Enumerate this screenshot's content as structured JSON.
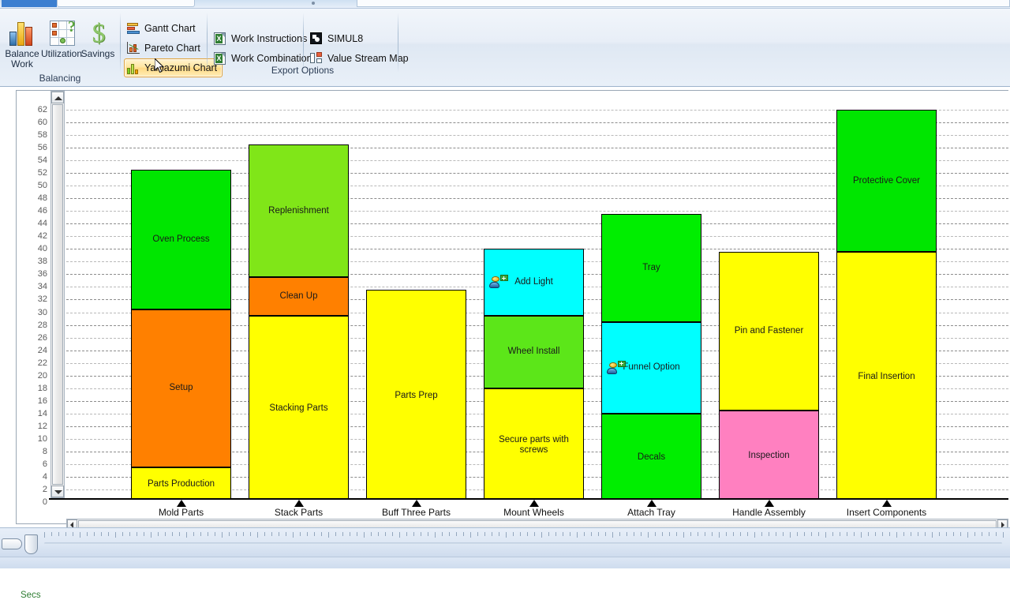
{
  "ribbon": {
    "groups": [
      {
        "name": "Balancing",
        "title": "Balancing"
      },
      {
        "name": "Export Options",
        "title": "Export Options"
      }
    ],
    "balancing": {
      "title": "Balancing",
      "buttons": [
        {
          "label_line1": "Balance",
          "label_line2": "Work",
          "icon": "bar-chart-icon"
        },
        {
          "label_line1": "Utilization",
          "label_line2": "",
          "icon": "grid-question-icon"
        },
        {
          "label_line1": "Savings",
          "label_line2": "",
          "icon": "dollar-icon"
        }
      ]
    },
    "chart_commands": [
      {
        "label": "Gantt Chart",
        "icon": "gantt-icon",
        "selected": false
      },
      {
        "label": "Pareto Chart",
        "icon": "pareto-icon",
        "selected": false
      },
      {
        "label": "Yamazumi Chart",
        "icon": "yamazumi-icon",
        "selected": true
      }
    ],
    "export": {
      "title": "Export Options",
      "commands": [
        {
          "label": "Work Instructions",
          "icon": "excel-icon"
        },
        {
          "label": "Work Combination",
          "icon": "excel-icon"
        },
        {
          "label": "SIMUL8",
          "icon": "simul8-icon"
        },
        {
          "label": "Value Stream Map",
          "icon": "value-stream-map-icon"
        }
      ]
    }
  },
  "chart_axis": {
    "y_unit_label": "Secs",
    "y_ticks": [
      62,
      60,
      58,
      56,
      54,
      52,
      50,
      48,
      46,
      44,
      42,
      40,
      38,
      36,
      34,
      32,
      30,
      28,
      26,
      24,
      22,
      20,
      18,
      16,
      14,
      12,
      10,
      8,
      6,
      4,
      2,
      0
    ]
  },
  "chart_data": {
    "type": "bar",
    "subtype": "stacked-yamazumi",
    "title": "Yamazumi Chart",
    "xlabel": "",
    "ylabel": "Secs",
    "ylim": [
      0,
      62
    ],
    "ytick_step": 2,
    "grid": true,
    "legend": "none",
    "categories": [
      "Mold Parts",
      "Stack Parts",
      "Buff Three Parts",
      "Mount Wheels",
      "Attach Tray",
      "Handle Assembly",
      "Insert Components"
    ],
    "totals": [
      52.5,
      56.5,
      33.5,
      40.0,
      45.5,
      39.5,
      62.0
    ],
    "series": [
      {
        "category": "Mold Parts",
        "total": 52.5,
        "segments": [
          {
            "label": "Parts Production",
            "value": 5.5,
            "color": "#ffff00",
            "resource_icon": false
          },
          {
            "label": "Setup",
            "value": 25.0,
            "color": "#ff8000",
            "resource_icon": false
          },
          {
            "label": "Oven Process",
            "value": 22.0,
            "color": "#00e600",
            "resource_icon": false
          }
        ]
      },
      {
        "category": "Stack Parts",
        "total": 56.5,
        "segments": [
          {
            "label": "Stacking Parts",
            "value": 29.5,
            "color": "#ffff00",
            "resource_icon": false
          },
          {
            "label": "Clean Up",
            "value": 6.0,
            "color": "#ff8000",
            "resource_icon": false
          },
          {
            "label": "Replenishment",
            "value": 21.0,
            "color": "#80e618",
            "resource_icon": false
          }
        ]
      },
      {
        "category": "Buff Three Parts",
        "total": 33.5,
        "segments": [
          {
            "label": "Parts Prep",
            "value": 33.5,
            "color": "#ffff00",
            "resource_icon": false
          }
        ]
      },
      {
        "category": "Mount Wheels",
        "total": 40.0,
        "segments": [
          {
            "label": "Secure parts with screws",
            "value": 18.0,
            "color": "#ffff00",
            "resource_icon": false
          },
          {
            "label": "Wheel Install",
            "value": 11.5,
            "color": "#5ce619",
            "resource_icon": false
          },
          {
            "label": "Add Light",
            "value": 10.5,
            "color": "#00ffff",
            "resource_icon": true
          }
        ]
      },
      {
        "category": "Attach Tray",
        "total": 45.5,
        "segments": [
          {
            "label": "Decals",
            "value": 14.0,
            "color": "#00ee00",
            "resource_icon": false
          },
          {
            "label": "Funnel Option",
            "value": 14.5,
            "color": "#00ffff",
            "resource_icon": true
          },
          {
            "label": "Tray",
            "value": 17.0,
            "color": "#00ee00",
            "resource_icon": false
          }
        ]
      },
      {
        "category": "Handle Assembly",
        "total": 39.5,
        "segments": [
          {
            "label": "Inspection",
            "value": 14.5,
            "color": "#ff80c0",
            "resource_icon": false
          },
          {
            "label": "Pin and Fastener",
            "value": 25.0,
            "color": "#ffff00",
            "resource_icon": false
          }
        ]
      },
      {
        "category": "Insert Components",
        "total": 62.0,
        "segments": [
          {
            "label": "Final Insertion",
            "value": 39.5,
            "color": "#ffff00",
            "resource_icon": false
          },
          {
            "label": "Protective Cover",
            "value": 22.5,
            "color": "#00e600",
            "resource_icon": false
          }
        ]
      }
    ]
  },
  "scrollbars": {
    "vertical_up_icon": "triangle-up-icon",
    "vertical_down_icon": "triangle-down-icon",
    "horizontal_left_icon": "triangle-left-icon",
    "horizontal_right_icon": "triangle-right-icon"
  },
  "statusbar": {
    "zoom_slider_icon": "zoom-slider",
    "tag_icon": "tag-button"
  },
  "colors": {
    "value_add_yellow": "#ffff00",
    "setup_orange": "#ff8000",
    "green": "#00e600",
    "light_green": "#80e618",
    "cyan": "#00ffff",
    "pink": "#ff80c0",
    "accent_highlight": "#ffd983",
    "axis_label_green": "#2e7d32"
  }
}
